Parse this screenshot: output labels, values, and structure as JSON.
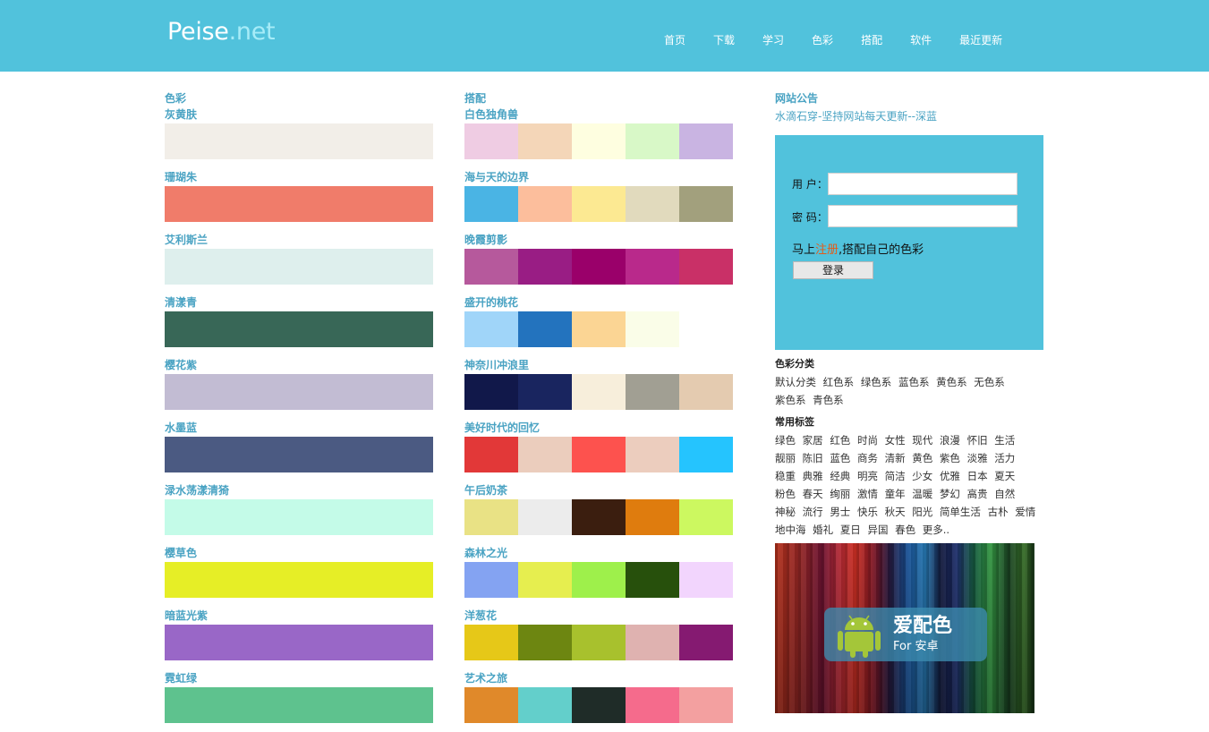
{
  "header": {
    "logo_main": "Peise",
    "logo_ext": ".net",
    "nav": [
      "首页",
      "下载",
      "学习",
      "色彩",
      "搭配",
      "软件",
      "最近更新"
    ]
  },
  "colors": {
    "title": "色彩",
    "items": [
      {
        "name": "灰黄肤",
        "color": "#f2eee8"
      },
      {
        "name": "珊瑚朱",
        "color": "#f07c6a"
      },
      {
        "name": "艾利斯兰",
        "color": "#deefed"
      },
      {
        "name": "清漾青",
        "color": "#386757"
      },
      {
        "name": "樱花紫",
        "color": "#c2bcd3"
      },
      {
        "name": "水墨蓝",
        "color": "#4b5a82"
      },
      {
        "name": "渌水荡漾清猗",
        "color": "#c4fbe8"
      },
      {
        "name": "樱草色",
        "color": "#e6ee26"
      },
      {
        "name": "暗蓝光紫",
        "color": "#9967c7"
      },
      {
        "name": "霓虹绿",
        "color": "#5ec28e"
      }
    ]
  },
  "combos": {
    "title": "搭配",
    "items": [
      {
        "name": "白色独角兽",
        "colors": [
          "#efcce3",
          "#f4d6b8",
          "#fefee0",
          "#d8f8c7",
          "#c9b4e2"
        ]
      },
      {
        "name": "海与天的边界",
        "colors": [
          "#4ab4e4",
          "#fcbe9c",
          "#fce992",
          "#e1dabd",
          "#a2a07d"
        ]
      },
      {
        "name": "晚霞剪影",
        "colors": [
          "#b6599c",
          "#991d84",
          "#9a006a",
          "#b9298b",
          "#c93067"
        ]
      },
      {
        "name": "盛开的桃花",
        "colors": [
          "#a0d5f9",
          "#2373be",
          "#fbd594",
          "#fafde8",
          "#ffffff"
        ]
      },
      {
        "name": "神奈川冲浪里",
        "colors": [
          "#11184a",
          "#19255f",
          "#f7eedb",
          "#a19f93",
          "#e4cbb0"
        ]
      },
      {
        "name": "美好时代的回忆",
        "colors": [
          "#e23838",
          "#ebcdbd",
          "#fd524e",
          "#eccdbe",
          "#25c4fe"
        ]
      },
      {
        "name": "午后奶茶",
        "colors": [
          "#e9e285",
          "#ececec",
          "#3b1e0f",
          "#df7c0e",
          "#ccf860"
        ]
      },
      {
        "name": "森林之光",
        "colors": [
          "#84a3f2",
          "#e6ee4f",
          "#9ef04b",
          "#27500c",
          "#f2d5fd"
        ]
      },
      {
        "name": "洋葱花",
        "colors": [
          "#e6c818",
          "#6d8611",
          "#a8c12d",
          "#dfb2b0",
          "#851a71"
        ]
      },
      {
        "name": "艺术之旅",
        "colors": [
          "#e0892a",
          "#63cfcb",
          "#1f2c28",
          "#f56b8c",
          "#f3a0a0"
        ]
      }
    ]
  },
  "sidebar": {
    "notice_title": "网站公告",
    "notice_text": "水滴石穿-坚持网站每天更新--深蓝",
    "login": {
      "user_label": "用 户：",
      "pass_label": "密 码：",
      "user_value": "",
      "pass_value": "",
      "register_prefix": "马上",
      "register_link": "注册",
      "register_suffix": ",搭配自己的色彩",
      "login_button": "登录"
    },
    "category_title": "色彩分类",
    "categories": [
      "默认分类",
      "红色系",
      "绿色系",
      "蓝色系",
      "黄色系",
      "无色系",
      "紫色系",
      "青色系"
    ],
    "tags_title": "常用标签",
    "tags": [
      "绿色",
      "家居",
      "红色",
      "时尚",
      "女性",
      "现代",
      "浪漫",
      "怀旧",
      "生活",
      "靓丽",
      "陈旧",
      "蓝色",
      "商务",
      "清新",
      "黄色",
      "紫色",
      "淡雅",
      "活力",
      "稳重",
      "典雅",
      "经典",
      "明亮",
      "简洁",
      "少女",
      "优雅",
      "日本",
      "夏天",
      "粉色",
      "春天",
      "绚丽",
      "激情",
      "童年",
      "温暖",
      "梦幻",
      "高贵",
      "自然",
      "神秘",
      "流行",
      "男士",
      "快乐",
      "秋天",
      "阳光",
      "简单生活",
      "古朴",
      "爱情",
      "地中海",
      "婚礼",
      "夏日",
      "异国",
      "春色",
      "更多.."
    ],
    "banner": {
      "title": "爱配色",
      "subtitle": "For 安卓"
    }
  }
}
